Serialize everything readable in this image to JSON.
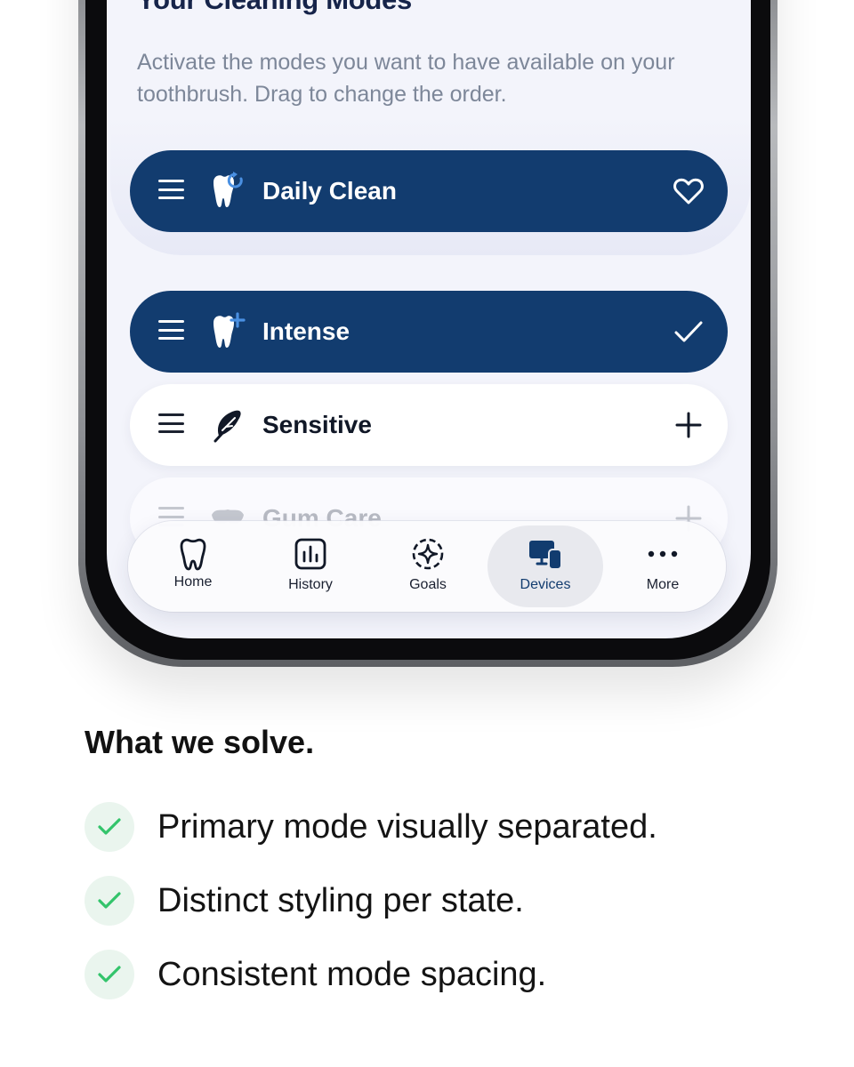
{
  "screen": {
    "title": "Your Cleaning Modes",
    "subtitle": "Activate the modes you want to have available on your toothbrush. Drag to change the order."
  },
  "primary_mode": {
    "label": "Daily Clean",
    "icon": "tooth-refresh-icon",
    "action_icon": "heart-icon"
  },
  "modes": [
    {
      "label": "Intense",
      "icon": "tooth-plus-icon",
      "state": "active",
      "action_icon": "checkmark-icon"
    },
    {
      "label": "Sensitive",
      "icon": "feather-icon",
      "state": "inactive",
      "action_icon": "plus-icon"
    },
    {
      "label": "Gum Care",
      "icon": "gum-icon",
      "state": "inactive",
      "action_icon": "plus-icon"
    }
  ],
  "tab_bar": {
    "items": [
      {
        "label": "Home",
        "icon": "tooth-icon"
      },
      {
        "label": "History",
        "icon": "bar-chart-icon"
      },
      {
        "label": "Goals",
        "icon": "target-icon"
      },
      {
        "label": "Devices",
        "icon": "devices-icon"
      },
      {
        "label": "More",
        "icon": "more-dots-icon"
      }
    ],
    "selected": "Devices"
  },
  "section": {
    "title": "What we solve.",
    "benefits": [
      "Primary mode visually separated.",
      "Distinct styling per state.",
      "Consistent mode spacing."
    ]
  },
  "colors": {
    "primary_navy": "#123c6f",
    "screen_bg": "#f3f4fb",
    "check_green": "#33c46b",
    "accent_blue": "#4a90e2"
  }
}
